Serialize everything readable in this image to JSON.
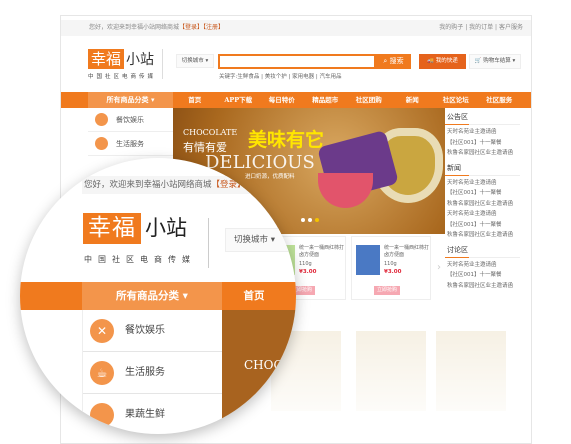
{
  "topbar": {
    "welcome": "您好，欢迎来到幸福小站网络商城",
    "login": "【登录】",
    "register": "【注册】",
    "links": [
      "我的购子",
      "我的订单",
      "客户服务"
    ]
  },
  "logo": {
    "main": "幸福",
    "sub": "小站",
    "tagline": "中国社区电商传媒"
  },
  "header": {
    "city": "切换城市 ▾",
    "search_placeholder": "",
    "search_button": "搜索",
    "keywords_label": "关键字:",
    "keywords": [
      "生鲜食品",
      "美妆个护",
      "家用电器",
      "汽车用品"
    ],
    "express": "我的快递",
    "cart": "购物车结算 ▾"
  },
  "nav": {
    "category": "所有商品分类 ▾",
    "items": [
      "首页",
      "APP下载",
      "每日特价",
      "精品超市",
      "社区团购",
      "新闻",
      "社区论坛",
      "社区服务"
    ]
  },
  "menu": [
    "餐饮娱乐",
    "生活服务",
    "果蔬生鲜"
  ],
  "banner": {
    "line1": "CHOCOLATE",
    "line2": "有情有爱",
    "headline": "美味有它",
    "big": "DELICIOUS",
    "sub": "进口奶源，优质配料"
  },
  "side": [
    {
      "title": "公告区",
      "items": [
        "天时名苑业主邀请函",
        "【社区001】十一聚餐",
        "秋鲁名家园社区业主邀请函"
      ]
    },
    {
      "title": "新闻",
      "items": [
        "天时名苑业主邀请函",
        "【社区001】十一聚餐",
        "秋鲁名家园社区业主邀请函",
        "天时名苑业主邀请函",
        "【社区001】十一聚餐",
        "秋鲁名家园社区业主邀请函"
      ]
    },
    {
      "title": "讨论区",
      "items": [
        "天时名苑业主邀请函",
        "【社区001】十一聚餐",
        "秋鲁名家园社区业主邀请函"
      ]
    }
  ],
  "products": [
    {
      "title": "统一来一桶西红柿打卤方便面",
      "weight": "110g",
      "price": "¥3.00",
      "buy": "立即抢购"
    },
    {
      "title": "统一来一桶西红柿打卤方便面",
      "weight": "110g",
      "price": "¥3.00",
      "buy": "立即抢购"
    }
  ],
  "colors": {
    "accent": "#f07a1e",
    "accent_light": "#f3954b",
    "price": "#e0283a"
  }
}
